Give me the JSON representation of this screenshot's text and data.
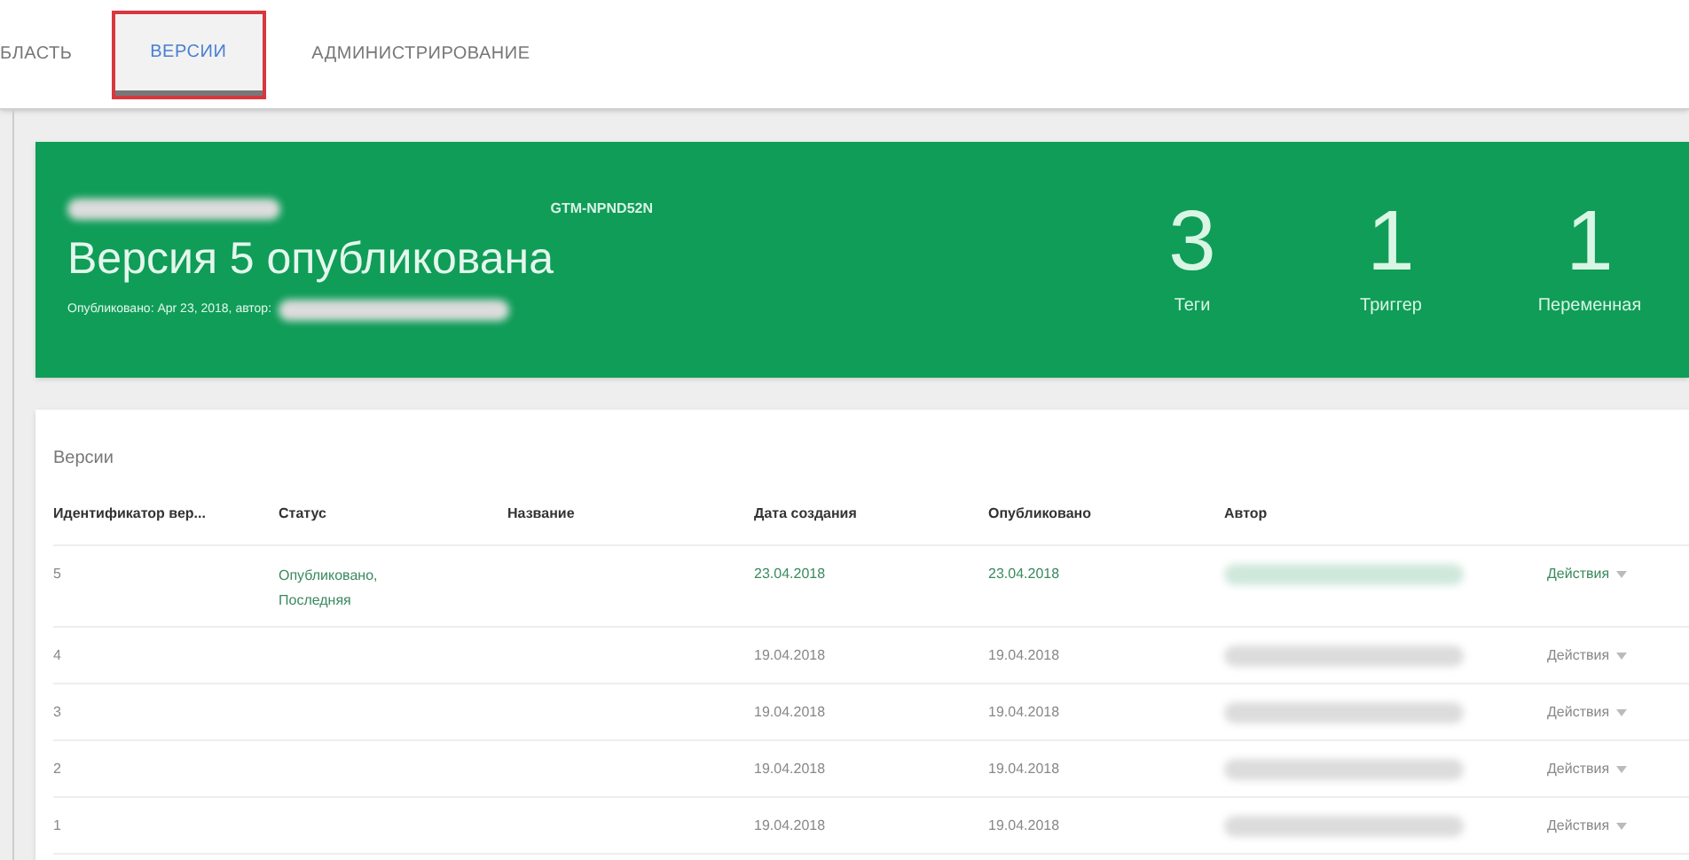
{
  "tabs": [
    {
      "label": "БЛАСТЬ",
      "selected": false
    },
    {
      "label": "ВЕРСИИ",
      "selected": true
    },
    {
      "label": "АДМИНИСТРИРОВАНИЕ",
      "selected": false
    }
  ],
  "header": {
    "container_id": "GTM-NPND52N",
    "title": "Версия 5 опубликована",
    "subtitle": "Опубликовано: Apr 23, 2018, автор:",
    "stats": [
      {
        "value": "3",
        "label": "Теги"
      },
      {
        "value": "1",
        "label": "Триггер"
      },
      {
        "value": "1",
        "label": "Переменная"
      }
    ]
  },
  "table": {
    "title": "Версии",
    "columns": [
      "Идентификатор вер...",
      "Статус",
      "Название",
      "Дата создания",
      "Опубликовано",
      "Автор"
    ],
    "rows": [
      {
        "id": "5",
        "status": [
          "Опубликовано,",
          "Последняя"
        ],
        "created": "23.04.2018",
        "published": "23.04.2018",
        "action": "Действия",
        "latest": true
      },
      {
        "id": "4",
        "status": [],
        "created": "19.04.2018",
        "published": "19.04.2018",
        "action": "Действия",
        "latest": false
      },
      {
        "id": "3",
        "status": [],
        "created": "19.04.2018",
        "published": "19.04.2018",
        "action": "Действия",
        "latest": false
      },
      {
        "id": "2",
        "status": [],
        "created": "19.04.2018",
        "published": "19.04.2018",
        "action": "Действия",
        "latest": false
      },
      {
        "id": "1",
        "status": [],
        "created": "19.04.2018",
        "published": "19.04.2018",
        "action": "Действия",
        "latest": false
      }
    ]
  }
}
